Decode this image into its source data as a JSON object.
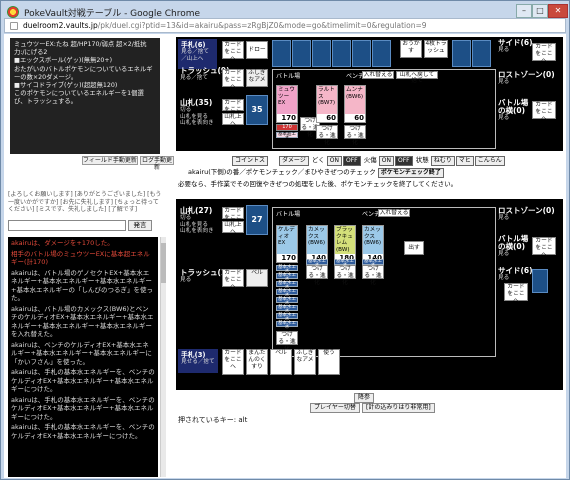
{
  "window": {
    "title": "PokeVault対戦テーブル - Google Chrome",
    "url_domain": "duelroom2.vaults.jp",
    "url_rest": "/pk/duel.cgi?ptid=13&id=akairu&pass=zRgBjZ0&mode=go&timelimit=0&regulation=9",
    "controls": {
      "min": "–",
      "max": "□",
      "close": "✕"
    }
  },
  "left": {
    "card_info": [
      "ミュウツーEX:たね 超/HP170/弱点 超×2/抵抗力:/にげる2",
      "■エックスボール(ゲッ)(無無20+)",
      "おたがいのバトルポケモンについているエネルギーの数×20ダメージ。",
      "■サイコドライブ(ゲッ)(超超無120)",
      "このポケモンについているエネルギーを1個選び、トラッシュする。"
    ],
    "buttons": {
      "field_toggle": "フィールド手動更新",
      "log_toggle": "ログ手動更新"
    },
    "hint": "[よろしくお願いします] [ありがとうございました] [もう一度いかがですか] [お先に失礼します] [ちょっと待ってください] [ミスです、失礼しました] [了解です]",
    "send_label": "発言",
    "log": [
      {
        "t": "akairuは、ダメージを+170した。",
        "red": true
      },
      {
        "t": "相手のバトル場のミュウツーEXに基本超エネルギー(計170)",
        "red": true
      },
      {
        "t": "akairuは、バトル場のゲノセクトEX+基本水エネルギー+基本水エネルギー+基本水エネルギー+基本水エネルギーの「しんぴのつるぎ」を使った。",
        "red": false
      },
      {
        "t": "akairuは、バトル場のカメックス(BW6)とベンチのケルディオEX+基本水エネルギー+基本水エネルギー+基本水エネルギー+基本水エネルギーを入れ替えた。",
        "red": false
      },
      {
        "t": "akairuは、ベンチのケルディオEX+基本水エネルギー+基本水エネルギー+基本水エネルギーに「かいフさん」を使った。",
        "red": false
      },
      {
        "t": "akairuは、手札の基本水エネルギーを、ベンチのケルディオEX+基本水エネルギー+基本水エネルギーにつけた。",
        "red": false
      },
      {
        "t": "akairuは、手札の基本水エネルギーを、ベンチのケルディオEX+基本水エネルギー+基本水エネルギーにつけた。",
        "red": false
      },
      {
        "t": "akairuは、手札の基本水エネルギーを、ベンチのケルディオEX+基本水エネルギーにつけた。",
        "red": false
      }
    ]
  },
  "opp": {
    "hand": {
      "title": "手札(6)",
      "sub": "見る／捨て／山上へ"
    },
    "hand_btns": [
      "カードをここへ",
      "ドロー"
    ],
    "deck_btns": [
      "おうかす",
      "4枚トラッシュ"
    ],
    "side": {
      "title": "サイド(6)",
      "sub": "見る",
      "btn": "カードをここへ"
    },
    "trash": {
      "title": "トラッシュ(9)",
      "sub": "見る／捨て",
      "btns": [
        "カードをここへ",
        "ふしぎなアメ"
      ]
    },
    "deck": {
      "title": "山札(35)",
      "sub": "切る\n山札を見る\n山札を表向き",
      "count": "35",
      "btns": [
        "カードをここへ",
        "山札上へ"
      ]
    },
    "battle_label": "バトル場",
    "bench_label": "ベンチ",
    "bench_swap": "入れ替える",
    "bench_discard": "山札へ戻して捨て",
    "active": {
      "name": "ミュウツーEX",
      "hp": "170",
      "dmg": "170"
    },
    "bench": [
      {
        "name": "ラルトス(BW7)",
        "hp": "60"
      },
      {
        "name": "ムンナ(BW6)",
        "hp": "60"
      }
    ],
    "energy_label": "基本超エネ",
    "btns": [
      "つける・進化",
      "つける・進化",
      "つける・進化"
    ],
    "lost": {
      "title": "ロストゾーン(0)",
      "sub": "見る"
    },
    "stadium": {
      "title": "バトル場の横(0)",
      "sub": "見る",
      "btn": "カードをここへ"
    }
  },
  "mid": {
    "coin": "コイントス",
    "damage": "ダメージ",
    "toku": "どく",
    "on": "ON",
    "off": "OFF",
    "burn": "火傷",
    "status": [
      "ねむり",
      "マヒ",
      "こんらん"
    ],
    "reset": "混乱",
    "status_label": "状態",
    "instr1": "akairu(下側)の番／ポケモンチェック／まひやきぜつのチェック",
    "check_btn": "ポケモンチェック終了",
    "instr2": "必要なら、手作業でその回復やきぜつの処理をした後、ポケモンチェックを終了してください。"
  },
  "me": {
    "deck": {
      "title": "山札(27)",
      "sub": "切る\n山札を見る\n山札を表向き",
      "count": "27",
      "btns": [
        "カードをここへ",
        "山札上へ"
      ]
    },
    "battle_label": "バトル場",
    "bench_label": "ベンチ",
    "bench_swap": "入れ替える",
    "active": {
      "name": "ケルディオEX",
      "hp": "170"
    },
    "bench": [
      {
        "name": "カメックス(BW6)",
        "hp": "140"
      },
      {
        "name": "ブラックキュレム(BW)",
        "hp": "180"
      },
      {
        "name": "カメックス(BW6)",
        "hp": "140"
      }
    ],
    "energy_label": "基本水エネ",
    "btns": [
      "つける・進化",
      "つける・進化",
      "つける・進化",
      "つける・進化"
    ],
    "out": "出す",
    "lost": {
      "title": "ロストゾーン(0)",
      "sub": "見る"
    },
    "stadium": {
      "title": "バトル場の横(0)",
      "sub": "見る",
      "btn": "カードをここへ"
    },
    "side": {
      "title": "サイド(6)",
      "sub": "見る",
      "btn": "カードをここへ"
    },
    "trash": {
      "title": "トラッシュ(12)",
      "sub": "見る",
      "btns": [
        "カードをここへ",
        "ベル"
      ]
    },
    "hand": {
      "title": "手札(3)",
      "sub": "見せる／捨て",
      "cards": [
        "カードをここへ",
        "まんたんのくすり",
        "ベル",
        "ふしぎなアメ",
        "使う"
      ]
    }
  },
  "bottom": {
    "draw": "降参",
    "player_change": "プレイヤー切替",
    "reload": "[計の込みりはり非常用]",
    "key_status": "押されているキー: alt"
  }
}
